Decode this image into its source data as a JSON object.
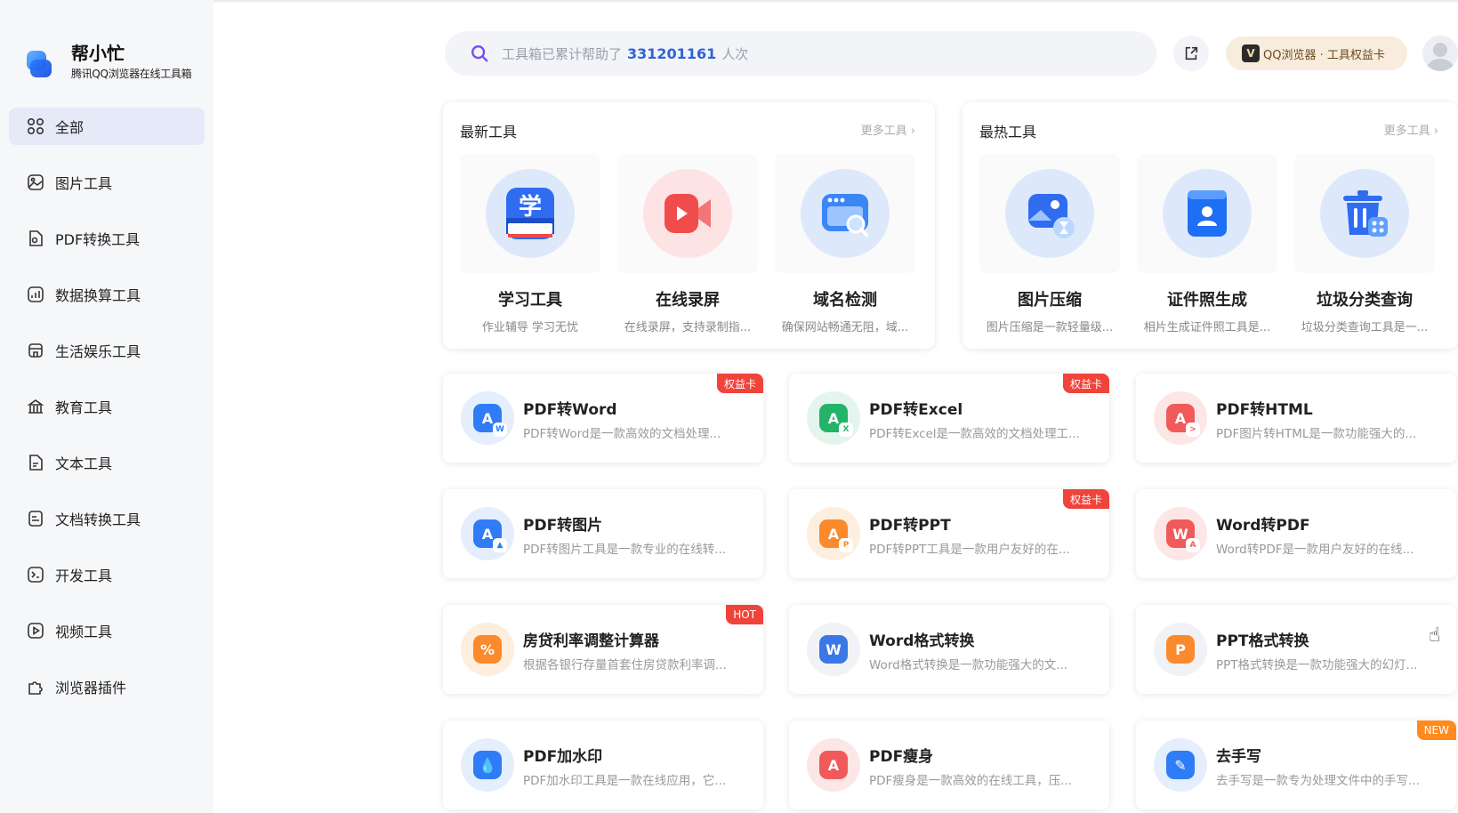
{
  "brand": {
    "title": "帮小忙",
    "subtitle": "腾讯QQ浏览器在线工具箱"
  },
  "sidebar": {
    "items": [
      {
        "label": "全部",
        "icon": "grid-icon",
        "active": true
      },
      {
        "label": "图片工具",
        "icon": "image-icon"
      },
      {
        "label": "PDF转换工具",
        "icon": "pdf-file-icon"
      },
      {
        "label": "数据换算工具",
        "icon": "chart-icon"
      },
      {
        "label": "生活娱乐工具",
        "icon": "store-icon"
      },
      {
        "label": "教育工具",
        "icon": "school-icon"
      },
      {
        "label": "文本工具",
        "icon": "text-file-icon"
      },
      {
        "label": "文档转换工具",
        "icon": "doc-convert-icon"
      },
      {
        "label": "开发工具",
        "icon": "terminal-icon"
      },
      {
        "label": "视频工具",
        "icon": "video-icon"
      },
      {
        "label": "浏览器插件",
        "icon": "puzzle-icon"
      }
    ]
  },
  "search": {
    "prefix": "工具箱已累计帮助了",
    "count": "331201161",
    "suffix": "人次"
  },
  "header": {
    "vip_logo": "V",
    "vip_label": "QQ浏览器 · 工具权益卡"
  },
  "panels": {
    "newest": {
      "title": "最新工具",
      "more": "更多工具",
      "items": [
        {
          "name": "学习工具",
          "desc": "作业辅导 学习无忧",
          "icon": "study-icon",
          "glyph": "学"
        },
        {
          "name": "在线录屏",
          "desc": "在线录屏，支持录制指...",
          "icon": "screen-record-icon"
        },
        {
          "name": "域名检测",
          "desc": "确保网站畅通无阻，域...",
          "icon": "domain-check-icon"
        }
      ]
    },
    "hottest": {
      "title": "最热工具",
      "more": "更多工具",
      "items": [
        {
          "name": "图片压缩",
          "desc": "图片压缩是一款轻量级...",
          "icon": "image-compress-icon"
        },
        {
          "name": "证件照生成",
          "desc": "相片生成证件照工具是...",
          "icon": "id-photo-icon"
        },
        {
          "name": "垃圾分类查询",
          "desc": "垃圾分类查询工具是一...",
          "icon": "trash-sort-icon"
        }
      ]
    }
  },
  "tools": [
    {
      "name": "PDF转Word",
      "desc": "PDF转Word是一款高效的文档处理...",
      "badge": "权益卡",
      "badge_color": "red",
      "icon": "pdf-to-word-icon",
      "bg": "#e4eefc",
      "fg": "#2f7cf6",
      "glyph": "A",
      "mini": "W",
      "mini_color": "#2f7cf6"
    },
    {
      "name": "PDF转Excel",
      "desc": "PDF转Excel是一款高效的文档处理工...",
      "badge": "权益卡",
      "badge_color": "red",
      "icon": "pdf-to-excel-icon",
      "bg": "#e3f5ec",
      "fg": "#23b46a",
      "glyph": "A",
      "mini": "X",
      "mini_color": "#23b46a"
    },
    {
      "name": "PDF转HTML",
      "desc": "PDF图片转HTML是一款功能强大的...",
      "badge": "",
      "badge_color": "",
      "icon": "pdf-to-html-icon",
      "bg": "#fde6e6",
      "fg": "#f15a5a",
      "glyph": "A",
      "mini": ">",
      "mini_color": "#f15a5a"
    },
    {
      "name": "PDF转图片",
      "desc": "PDF转图片工具是一款专业的在线转...",
      "badge": "",
      "badge_color": "",
      "icon": "pdf-to-image-icon",
      "bg": "#e4eefc",
      "fg": "#2f7cf6",
      "glyph": "A",
      "mini": "▲",
      "mini_color": "#2f7cf6"
    },
    {
      "name": "PDF转PPT",
      "desc": "PDF转PPT工具是一款用户友好的在...",
      "badge": "权益卡",
      "badge_color": "red",
      "icon": "pdf-to-ppt-icon",
      "bg": "#fdeedd",
      "fg": "#fa8a2c",
      "glyph": "A",
      "mini": "P",
      "mini_color": "#fa8a2c"
    },
    {
      "name": "Word转PDF",
      "desc": "Word转PDF是一款用户友好的在线...",
      "badge": "",
      "badge_color": "",
      "icon": "word-to-pdf-icon",
      "bg": "#fde6e6",
      "fg": "#f15a5a",
      "glyph": "W",
      "mini": "A",
      "mini_color": "#f15a5a"
    },
    {
      "name": "房贷利率调整计算器",
      "desc": "根据各银行存量首套住房贷款利率调...",
      "badge": "HOT",
      "badge_color": "red",
      "icon": "mortgage-calculator-icon",
      "bg": "#fdeedd",
      "fg": "#fa8a2c",
      "glyph": "%",
      "mini": "",
      "mini_color": ""
    },
    {
      "name": "Word格式转换",
      "desc": "Word格式转换是一款功能强大的文...",
      "badge": "",
      "badge_color": "",
      "icon": "word-format-icon",
      "bg": "#f1f2f5",
      "fg": "#3b78e7",
      "glyph": "W",
      "mini": "",
      "mini_color": ""
    },
    {
      "name": "PPT格式转换",
      "desc": "PPT格式转换是一款功能强大的幻灯...",
      "badge": "",
      "badge_color": "",
      "icon": "ppt-format-icon",
      "bg": "#f1f2f5",
      "fg": "#fa8a2c",
      "glyph": "P",
      "mini": "",
      "mini_color": ""
    },
    {
      "name": "PDF加水印",
      "desc": "PDF加水印工具是一款在线应用，它...",
      "badge": "",
      "badge_color": "",
      "icon": "pdf-watermark-icon",
      "bg": "#e4eefc",
      "fg": "#2f7cf6",
      "glyph": "💧",
      "mini": "",
      "mini_color": ""
    },
    {
      "name": "PDF瘦身",
      "desc": "PDF瘦身是一款高效的在线工具，压...",
      "badge": "",
      "badge_color": "",
      "icon": "pdf-compress-icon",
      "bg": "#fde6e6",
      "fg": "#f15a5a",
      "glyph": "A",
      "mini": "",
      "mini_color": ""
    },
    {
      "name": "去手写",
      "desc": "去手写是一款专为处理文件中的手写...",
      "badge": "NEW",
      "badge_color": "orange",
      "icon": "remove-handwriting-icon",
      "bg": "#e4eefc",
      "fg": "#2f7cf6",
      "glyph": "✎",
      "mini": "",
      "mini_color": ""
    }
  ]
}
